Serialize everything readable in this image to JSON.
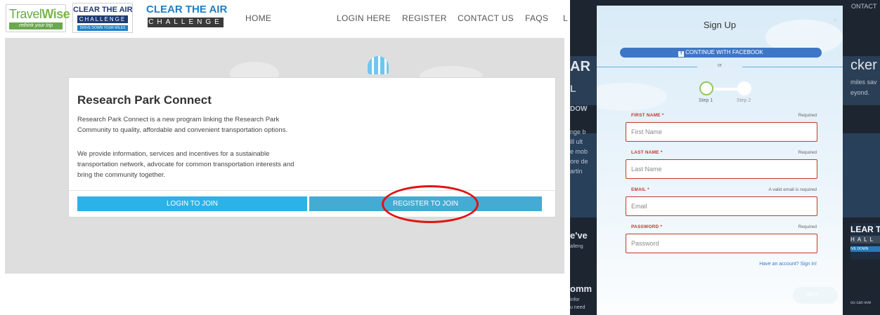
{
  "left": {
    "logos": {
      "travelwise": {
        "name_light": "Travel",
        "name_bold": "Wise",
        "tagline": "rethink your trip"
      },
      "cta_small": {
        "line1": "CLEAR THE AIR",
        "line2": "CHALLENGE",
        "line3": "DRIVE DOWN YOUR MILES"
      },
      "cta_large": {
        "line1": "CLEAR THE AIR",
        "line2": "CHALLENGE"
      }
    },
    "nav": {
      "home": "HOME",
      "login": "LOGIN HERE",
      "register": "REGISTER",
      "contact": "CONTACT US",
      "faqs": "FAQS",
      "overflow": "L"
    },
    "card": {
      "title": "Research Park Connect",
      "para1": "Research Park Connect is a new program linking the Research Park Community to quality, affordable and convenient transportation options.",
      "para2": "We provide information, services and incentives for a sustainable transportation network, advocate for common transportation interests and bring the community together.",
      "login_btn": "LOGIN TO JOIN",
      "register_btn": "REGISTER TO JOIN"
    },
    "colors": {
      "button_blue": "#2bb3e8",
      "highlight_oval": "#e01414"
    }
  },
  "right": {
    "background": {
      "top_right": "ONTACT",
      "frag_ar": "AR",
      "frag_l": "L",
      "frag_dow": "DOW",
      "frag_nge": "nge b",
      "frag_ill": "ill ult",
      "frag_mo": "e mob",
      "frag_ore": "ore de",
      "frag_art": "artin",
      "frag_cker": "cker",
      "frag_miles": "miles sav",
      "frag_yond": "eyond.",
      "frag_ve": "e've",
      "frag_alleng": "alleng",
      "frag_omm": "omm",
      "frag_infor": "infor",
      "frag_need": "u need",
      "frag_you": "ou can eve",
      "logo_a": "LEAR T",
      "logo_b": "HALL",
      "logo_c": "IVE DOWN"
    },
    "modal": {
      "title": "Sign Up",
      "close": "×",
      "facebook_btn": "CONTINUE WITH FACEBOOK",
      "or": "or",
      "step1": "Step 1",
      "step2": "Step 2",
      "first_name": {
        "label": "FIRST NAME *",
        "hint": "Required",
        "placeholder": "First Name",
        "value": ""
      },
      "last_name": {
        "label": "LAST NAME *",
        "hint": "Required",
        "placeholder": "Last Name",
        "value": ""
      },
      "email": {
        "label": "EMAIL *",
        "hint": "A valid email is required",
        "placeholder": "Email",
        "value": ""
      },
      "password": {
        "label": "PASSWORD *",
        "hint": "Required",
        "placeholder": "Password",
        "value": ""
      },
      "have_account": "Have an account? Sign in!",
      "next_btn": "NEXT →"
    },
    "colors": {
      "error_red": "#c0392b",
      "facebook_blue": "#3d76c5",
      "step_green": "#8fca5a"
    }
  }
}
